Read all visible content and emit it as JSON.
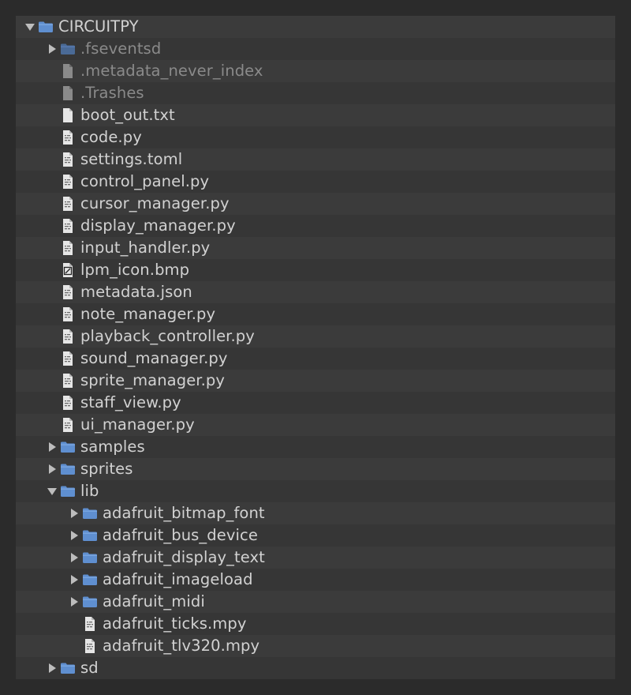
{
  "colors": {
    "text": "#d2d2d2",
    "dim_text": "#8a8a8a",
    "folder": "#5f8fd0",
    "row_even": "#3b3b3b",
    "row_odd": "#363636",
    "background": "#2b2b2b"
  },
  "tree": [
    {
      "label": "CIRCUITPY",
      "depth": 0,
      "kind": "folder",
      "expander": "open",
      "name": "circuitpy"
    },
    {
      "label": ".fseventsd",
      "depth": 1,
      "kind": "folder",
      "expander": "closed",
      "dim": true,
      "name": "fseventsd"
    },
    {
      "label": ".metadata_never_index",
      "depth": 1,
      "kind": "blank-file",
      "dim": true,
      "name": "metadata-never-index"
    },
    {
      "label": ".Trashes",
      "depth": 1,
      "kind": "blank-file",
      "dim": true,
      "name": "trashes"
    },
    {
      "label": "boot_out.txt",
      "depth": 1,
      "kind": "blank-file",
      "name": "boot-out-txt"
    },
    {
      "label": "code.py",
      "depth": 1,
      "kind": "code-file",
      "name": "code-py"
    },
    {
      "label": "settings.toml",
      "depth": 1,
      "kind": "code-file",
      "name": "settings-toml"
    },
    {
      "label": "control_panel.py",
      "depth": 1,
      "kind": "code-file",
      "name": "control-panel-py"
    },
    {
      "label": "cursor_manager.py",
      "depth": 1,
      "kind": "code-file",
      "name": "cursor-manager-py"
    },
    {
      "label": "display_manager.py",
      "depth": 1,
      "kind": "code-file",
      "name": "display-manager-py"
    },
    {
      "label": "input_handler.py",
      "depth": 1,
      "kind": "code-file",
      "name": "input-handler-py"
    },
    {
      "label": "lpm_icon.bmp",
      "depth": 1,
      "kind": "image-file",
      "name": "lpm-icon-bmp"
    },
    {
      "label": "metadata.json",
      "depth": 1,
      "kind": "code-file",
      "name": "metadata-json"
    },
    {
      "label": "note_manager.py",
      "depth": 1,
      "kind": "code-file",
      "name": "note-manager-py"
    },
    {
      "label": "playback_controller.py",
      "depth": 1,
      "kind": "code-file",
      "name": "playback-controller-py"
    },
    {
      "label": "sound_manager.py",
      "depth": 1,
      "kind": "code-file",
      "name": "sound-manager-py"
    },
    {
      "label": "sprite_manager.py",
      "depth": 1,
      "kind": "code-file",
      "name": "sprite-manager-py"
    },
    {
      "label": "staff_view.py",
      "depth": 1,
      "kind": "code-file",
      "name": "staff-view-py"
    },
    {
      "label": "ui_manager.py",
      "depth": 1,
      "kind": "code-file",
      "name": "ui-manager-py"
    },
    {
      "label": "samples",
      "depth": 1,
      "kind": "folder",
      "expander": "closed",
      "name": "samples"
    },
    {
      "label": "sprites",
      "depth": 1,
      "kind": "folder",
      "expander": "closed",
      "name": "sprites"
    },
    {
      "label": "lib",
      "depth": 1,
      "kind": "folder",
      "expander": "open",
      "name": "lib"
    },
    {
      "label": "adafruit_bitmap_font",
      "depth": 2,
      "kind": "folder",
      "expander": "closed",
      "name": "adafruit-bitmap-font"
    },
    {
      "label": "adafruit_bus_device",
      "depth": 2,
      "kind": "folder",
      "expander": "closed",
      "name": "adafruit-bus-device"
    },
    {
      "label": "adafruit_display_text",
      "depth": 2,
      "kind": "folder",
      "expander": "closed",
      "name": "adafruit-display-text"
    },
    {
      "label": "adafruit_imageload",
      "depth": 2,
      "kind": "folder",
      "expander": "closed",
      "name": "adafruit-imageload"
    },
    {
      "label": "adafruit_midi",
      "depth": 2,
      "kind": "folder",
      "expander": "closed",
      "name": "adafruit-midi"
    },
    {
      "label": "adafruit_ticks.mpy",
      "depth": 2,
      "kind": "code-file",
      "name": "adafruit-ticks-mpy"
    },
    {
      "label": "adafruit_tlv320.mpy",
      "depth": 2,
      "kind": "code-file",
      "name": "adafruit-tlv320-mpy"
    },
    {
      "label": "sd",
      "depth": 1,
      "kind": "folder",
      "expander": "closed",
      "name": "sd"
    }
  ]
}
